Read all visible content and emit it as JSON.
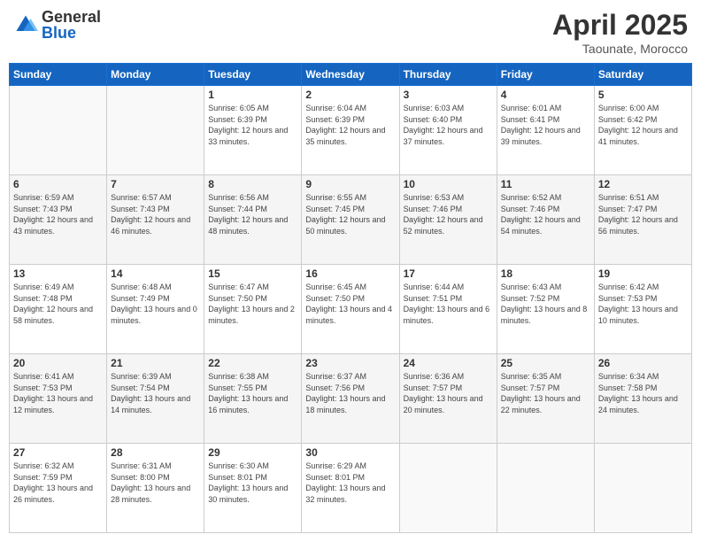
{
  "header": {
    "logo": {
      "general": "General",
      "blue": "Blue"
    },
    "title": "April 2025",
    "subtitle": "Taounate, Morocco"
  },
  "days_of_week": [
    "Sunday",
    "Monday",
    "Tuesday",
    "Wednesday",
    "Thursday",
    "Friday",
    "Saturday"
  ],
  "weeks": [
    [
      {
        "day": "",
        "info": ""
      },
      {
        "day": "",
        "info": ""
      },
      {
        "day": "1",
        "info": "Sunrise: 6:05 AM\nSunset: 6:39 PM\nDaylight: 12 hours and 33 minutes."
      },
      {
        "day": "2",
        "info": "Sunrise: 6:04 AM\nSunset: 6:39 PM\nDaylight: 12 hours and 35 minutes."
      },
      {
        "day": "3",
        "info": "Sunrise: 6:03 AM\nSunset: 6:40 PM\nDaylight: 12 hours and 37 minutes."
      },
      {
        "day": "4",
        "info": "Sunrise: 6:01 AM\nSunset: 6:41 PM\nDaylight: 12 hours and 39 minutes."
      },
      {
        "day": "5",
        "info": "Sunrise: 6:00 AM\nSunset: 6:42 PM\nDaylight: 12 hours and 41 minutes."
      }
    ],
    [
      {
        "day": "6",
        "info": "Sunrise: 6:59 AM\nSunset: 7:43 PM\nDaylight: 12 hours and 43 minutes."
      },
      {
        "day": "7",
        "info": "Sunrise: 6:57 AM\nSunset: 7:43 PM\nDaylight: 12 hours and 46 minutes."
      },
      {
        "day": "8",
        "info": "Sunrise: 6:56 AM\nSunset: 7:44 PM\nDaylight: 12 hours and 48 minutes."
      },
      {
        "day": "9",
        "info": "Sunrise: 6:55 AM\nSunset: 7:45 PM\nDaylight: 12 hours and 50 minutes."
      },
      {
        "day": "10",
        "info": "Sunrise: 6:53 AM\nSunset: 7:46 PM\nDaylight: 12 hours and 52 minutes."
      },
      {
        "day": "11",
        "info": "Sunrise: 6:52 AM\nSunset: 7:46 PM\nDaylight: 12 hours and 54 minutes."
      },
      {
        "day": "12",
        "info": "Sunrise: 6:51 AM\nSunset: 7:47 PM\nDaylight: 12 hours and 56 minutes."
      }
    ],
    [
      {
        "day": "13",
        "info": "Sunrise: 6:49 AM\nSunset: 7:48 PM\nDaylight: 12 hours and 58 minutes."
      },
      {
        "day": "14",
        "info": "Sunrise: 6:48 AM\nSunset: 7:49 PM\nDaylight: 13 hours and 0 minutes."
      },
      {
        "day": "15",
        "info": "Sunrise: 6:47 AM\nSunset: 7:50 PM\nDaylight: 13 hours and 2 minutes."
      },
      {
        "day": "16",
        "info": "Sunrise: 6:45 AM\nSunset: 7:50 PM\nDaylight: 13 hours and 4 minutes."
      },
      {
        "day": "17",
        "info": "Sunrise: 6:44 AM\nSunset: 7:51 PM\nDaylight: 13 hours and 6 minutes."
      },
      {
        "day": "18",
        "info": "Sunrise: 6:43 AM\nSunset: 7:52 PM\nDaylight: 13 hours and 8 minutes."
      },
      {
        "day": "19",
        "info": "Sunrise: 6:42 AM\nSunset: 7:53 PM\nDaylight: 13 hours and 10 minutes."
      }
    ],
    [
      {
        "day": "20",
        "info": "Sunrise: 6:41 AM\nSunset: 7:53 PM\nDaylight: 13 hours and 12 minutes."
      },
      {
        "day": "21",
        "info": "Sunrise: 6:39 AM\nSunset: 7:54 PM\nDaylight: 13 hours and 14 minutes."
      },
      {
        "day": "22",
        "info": "Sunrise: 6:38 AM\nSunset: 7:55 PM\nDaylight: 13 hours and 16 minutes."
      },
      {
        "day": "23",
        "info": "Sunrise: 6:37 AM\nSunset: 7:56 PM\nDaylight: 13 hours and 18 minutes."
      },
      {
        "day": "24",
        "info": "Sunrise: 6:36 AM\nSunset: 7:57 PM\nDaylight: 13 hours and 20 minutes."
      },
      {
        "day": "25",
        "info": "Sunrise: 6:35 AM\nSunset: 7:57 PM\nDaylight: 13 hours and 22 minutes."
      },
      {
        "day": "26",
        "info": "Sunrise: 6:34 AM\nSunset: 7:58 PM\nDaylight: 13 hours and 24 minutes."
      }
    ],
    [
      {
        "day": "27",
        "info": "Sunrise: 6:32 AM\nSunset: 7:59 PM\nDaylight: 13 hours and 26 minutes."
      },
      {
        "day": "28",
        "info": "Sunrise: 6:31 AM\nSunset: 8:00 PM\nDaylight: 13 hours and 28 minutes."
      },
      {
        "day": "29",
        "info": "Sunrise: 6:30 AM\nSunset: 8:01 PM\nDaylight: 13 hours and 30 minutes."
      },
      {
        "day": "30",
        "info": "Sunrise: 6:29 AM\nSunset: 8:01 PM\nDaylight: 13 hours and 32 minutes."
      },
      {
        "day": "",
        "info": ""
      },
      {
        "day": "",
        "info": ""
      },
      {
        "day": "",
        "info": ""
      }
    ]
  ]
}
